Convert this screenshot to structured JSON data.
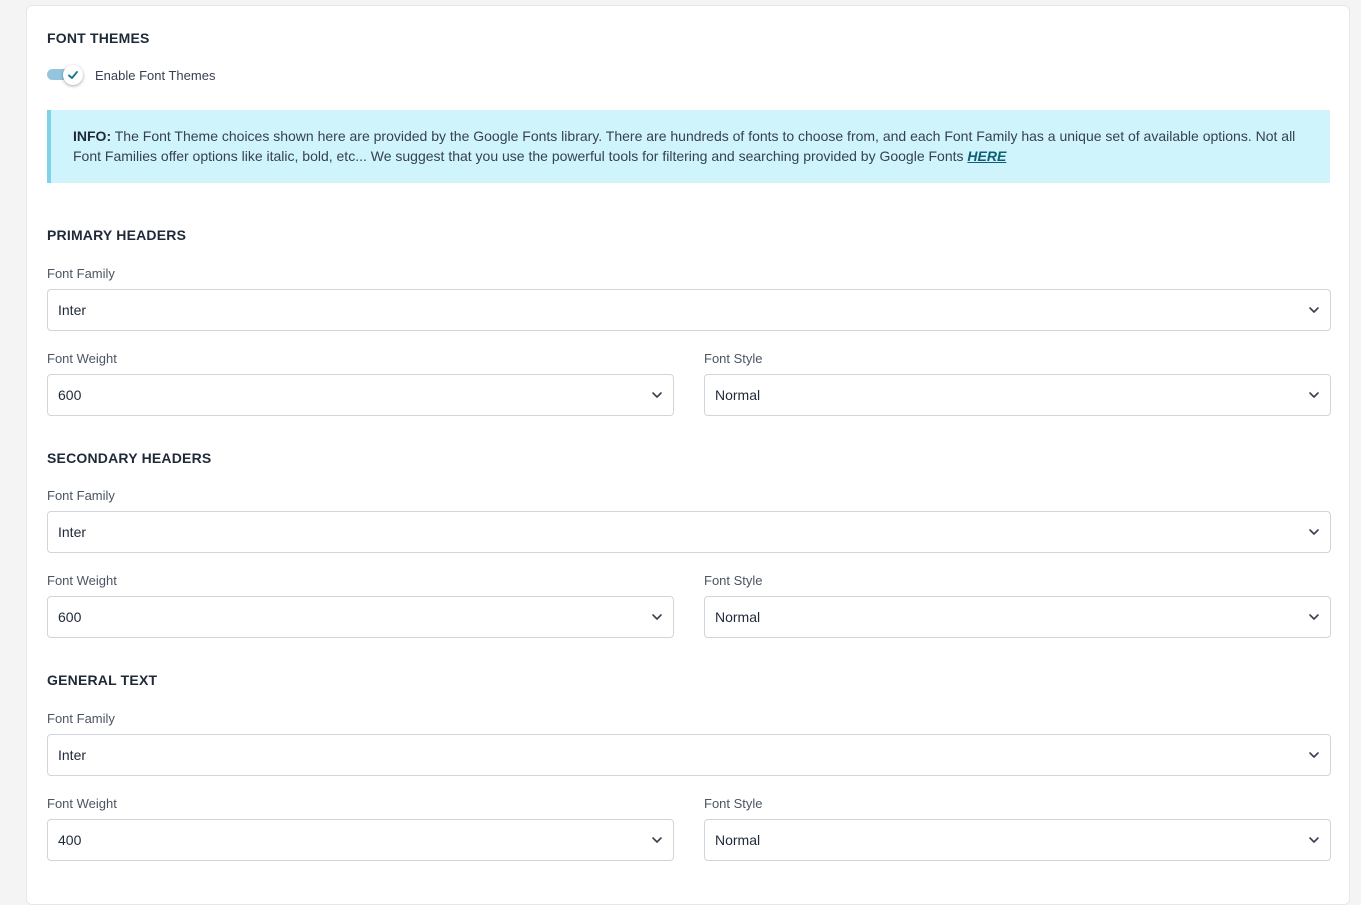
{
  "font_themes": {
    "title": "FONT THEMES",
    "enable_label": "Enable Font Themes",
    "enabled": true
  },
  "info": {
    "prefix": "INFO:",
    "text": "The Font Theme choices shown here are provided by the Google Fonts library. There are hundreds of fonts to choose from, and each Font Family has a unique set of available options. Not all Font Families offer options like italic, bold, etc... We suggest that you use the powerful tools for filtering and searching provided by Google Fonts",
    "link_text": "HERE"
  },
  "colors": {
    "toggle_track": "#93c5dd",
    "info_bg": "#cff4fc",
    "info_border": "#7fd3e6",
    "link": "#0c5f75",
    "check": "#0e7490"
  },
  "primary": {
    "title": "PRIMARY HEADERS",
    "family_label": "Font Family",
    "family_value": "Inter",
    "weight_label": "Font Weight",
    "weight_value": "600",
    "style_label": "Font Style",
    "style_value": "Normal"
  },
  "secondary": {
    "title": "SECONDARY HEADERS",
    "family_label": "Font Family",
    "family_value": "Inter",
    "weight_label": "Font Weight",
    "weight_value": "600",
    "style_label": "Font Style",
    "style_value": "Normal"
  },
  "general": {
    "title": "GENERAL TEXT",
    "family_label": "Font Family",
    "family_value": "Inter",
    "weight_label": "Font Weight",
    "weight_value": "400",
    "style_label": "Font Style",
    "style_value": "Normal"
  },
  "icons": {
    "toggle_check": "check-icon",
    "select_arrow": "chevron-down-icon"
  }
}
